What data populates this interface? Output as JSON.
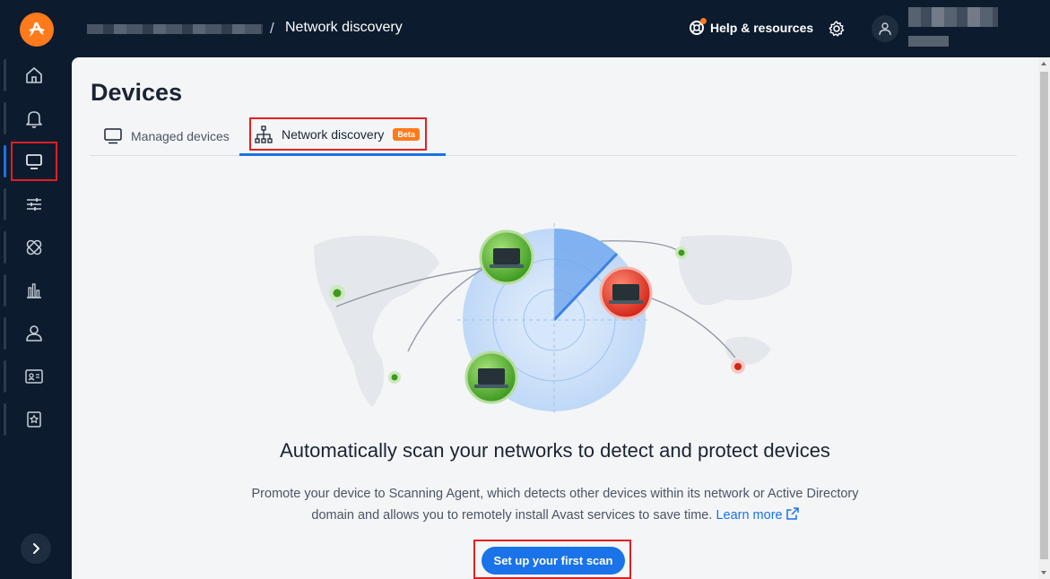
{
  "header": {
    "breadcrumb_current": "Network discovery",
    "breadcrumb_separator": "/",
    "help_label": "Help & resources"
  },
  "sidebar": {
    "items": [
      {
        "icon": "home-icon"
      },
      {
        "icon": "bell-icon"
      },
      {
        "icon": "monitor-icon",
        "active": true
      },
      {
        "icon": "sliders-icon"
      },
      {
        "icon": "bandage-icon"
      },
      {
        "icon": "bar-chart-icon"
      },
      {
        "icon": "user-icon"
      },
      {
        "icon": "id-card-icon"
      },
      {
        "icon": "badge-star-icon"
      }
    ],
    "expand_icon": "chevron-right-icon"
  },
  "page": {
    "title": "Devices",
    "tabs": [
      {
        "label": "Managed devices",
        "icon": "monitor-icon"
      },
      {
        "label": "Network discovery",
        "icon": "network-tree-icon",
        "badge": "Beta",
        "active": true
      }
    ]
  },
  "content": {
    "headline": "Automatically scan your networks to detect and protect devices",
    "description": "Promote your device to Scanning Agent, which detects other devices within its network or Active Directory domain and allows you to remotely install Avast services to save time.",
    "learn_more": "Learn more",
    "cta_label": "Set up your first scan"
  },
  "colors": {
    "accent": "#1a73e8",
    "brand": "#ff7a1a",
    "nav_bg": "#0c1b2e",
    "device_ok": "#5cb83a",
    "device_alert": "#e83b2f"
  }
}
